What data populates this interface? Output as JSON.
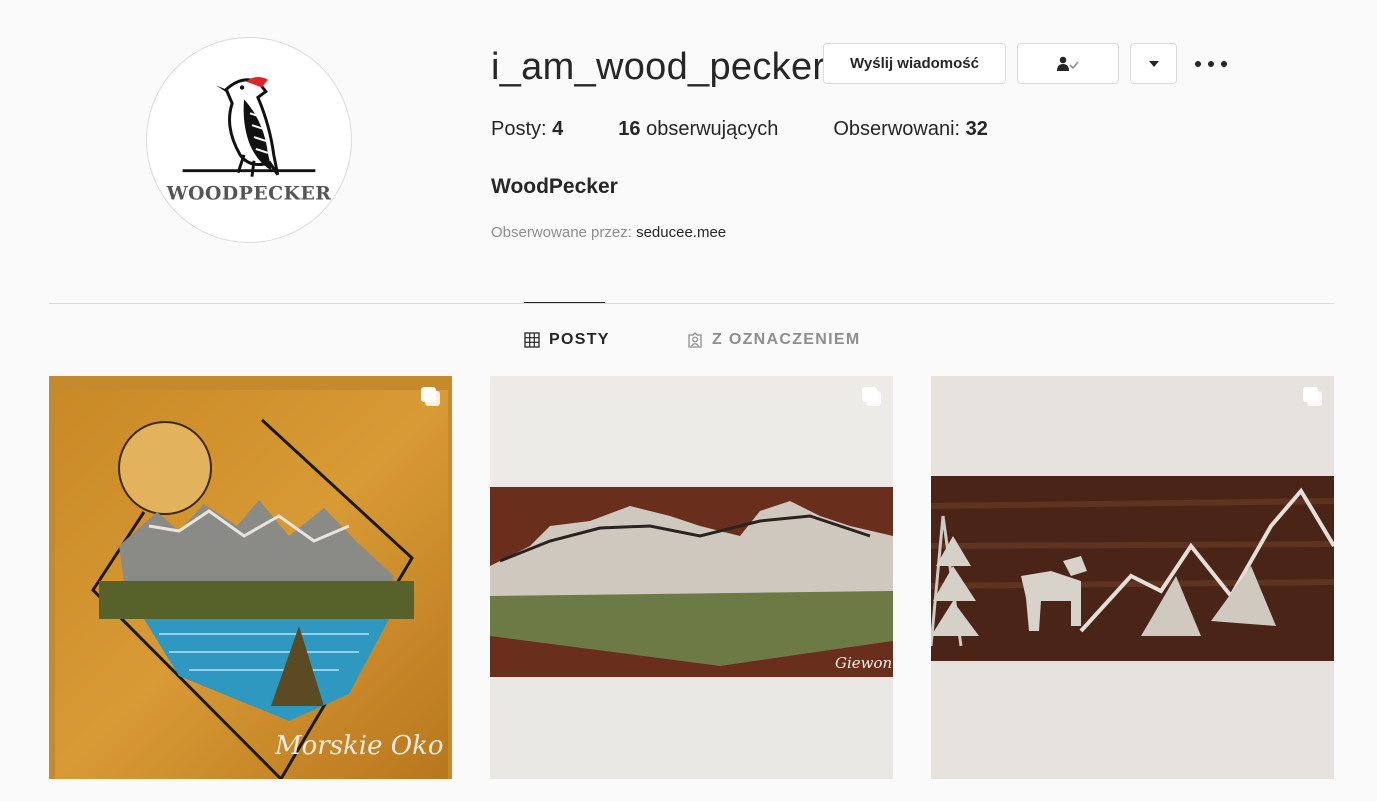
{
  "profile": {
    "username": "i_am_wood_pecker",
    "full_name": "WoodPecker",
    "avatar_icon": "woodpecker-logo",
    "avatar_text": "WOODPECKER"
  },
  "actions": {
    "message_label": "Wyślij wiadomość",
    "following_icon": "person-check-icon",
    "dropdown_icon": "caret-down-icon",
    "more_icon": "ellipsis-icon"
  },
  "stats": {
    "posts_label": "Posty:",
    "posts_count": "4",
    "followers_count": "16",
    "followers_label": "obserwujących",
    "following_label": "Obserwowani:",
    "following_count": "32"
  },
  "followed_by": {
    "label": "Obserwowane przez:",
    "name": "seducee.mee"
  },
  "tabs": [
    {
      "label": "POSTY",
      "icon": "grid-icon",
      "active": true
    },
    {
      "label": "Z OZNACZENIEM",
      "icon": "tagged-person-icon",
      "active": false
    }
  ],
  "posts": [
    {
      "caption": "Morskie Oko",
      "type": "carousel"
    },
    {
      "caption": "Giewont",
      "type": "carousel"
    },
    {
      "caption": "",
      "type": "carousel"
    }
  ],
  "colors": {
    "text": "#262626",
    "muted": "#8e8e8e",
    "border": "#dbdbdb",
    "background": "#fafafa",
    "woodpecker_red": "#e0242a"
  }
}
